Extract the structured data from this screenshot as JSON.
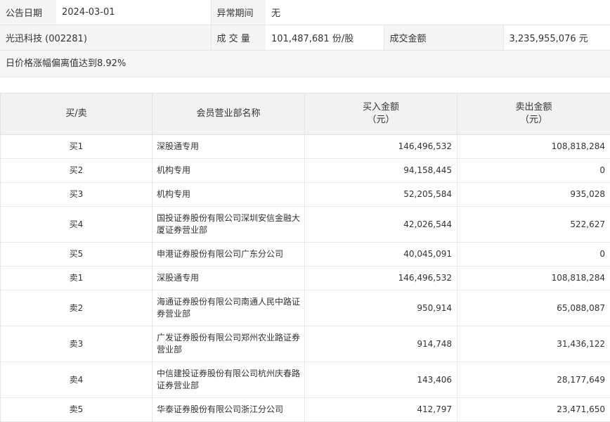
{
  "info": {
    "date_label": "公告日期",
    "date_value": "2024-03-01",
    "abnormal_label": "异常期间",
    "abnormal_value": "无",
    "stock_name": "光迅科技 (002281)",
    "volume_label": "成 交 量",
    "volume_value": "101,487,681 份/股",
    "amount_label": "成交金额",
    "amount_value": "3,235,955,076 元",
    "note": "日价格涨幅偏离值达到8.92%"
  },
  "table": {
    "headers": {
      "side": "买/卖",
      "dept": "会员营业部名称",
      "buy_line1": "买入金额",
      "buy_line2": "（元）",
      "sell_line1": "卖出金额",
      "sell_line2": "（元）"
    },
    "rows": [
      {
        "side": "买1",
        "dept": "深股通专用",
        "buy": "146,496,532",
        "sell": "108,818,284"
      },
      {
        "side": "买2",
        "dept": "机构专用",
        "buy": "94,158,445",
        "sell": "0"
      },
      {
        "side": "买3",
        "dept": "机构专用",
        "buy": "52,205,584",
        "sell": "935,028"
      },
      {
        "side": "买4",
        "dept": "国投证券股份有限公司深圳安信金融大厦证券营业部",
        "buy": "42,026,544",
        "sell": "522,627"
      },
      {
        "side": "买5",
        "dept": "申港证券股份有限公司广东分公司",
        "buy": "40,045,091",
        "sell": "0"
      },
      {
        "side": "卖1",
        "dept": "深股通专用",
        "buy": "146,496,532",
        "sell": "108,818,284"
      },
      {
        "side": "卖2",
        "dept": "海通证券股份有限公司南通人民中路证券营业部",
        "buy": "950,914",
        "sell": "65,088,087"
      },
      {
        "side": "卖3",
        "dept": "广发证券股份有限公司郑州农业路证券营业部",
        "buy": "914,748",
        "sell": "31,436,122"
      },
      {
        "side": "卖4",
        "dept": "中信建投证券股份有限公司杭州庆春路证券营业部",
        "buy": "143,406",
        "sell": "28,177,649"
      },
      {
        "side": "卖5",
        "dept": "华泰证券股份有限公司浙江分公司",
        "buy": "412,797",
        "sell": "23,471,650"
      }
    ]
  }
}
